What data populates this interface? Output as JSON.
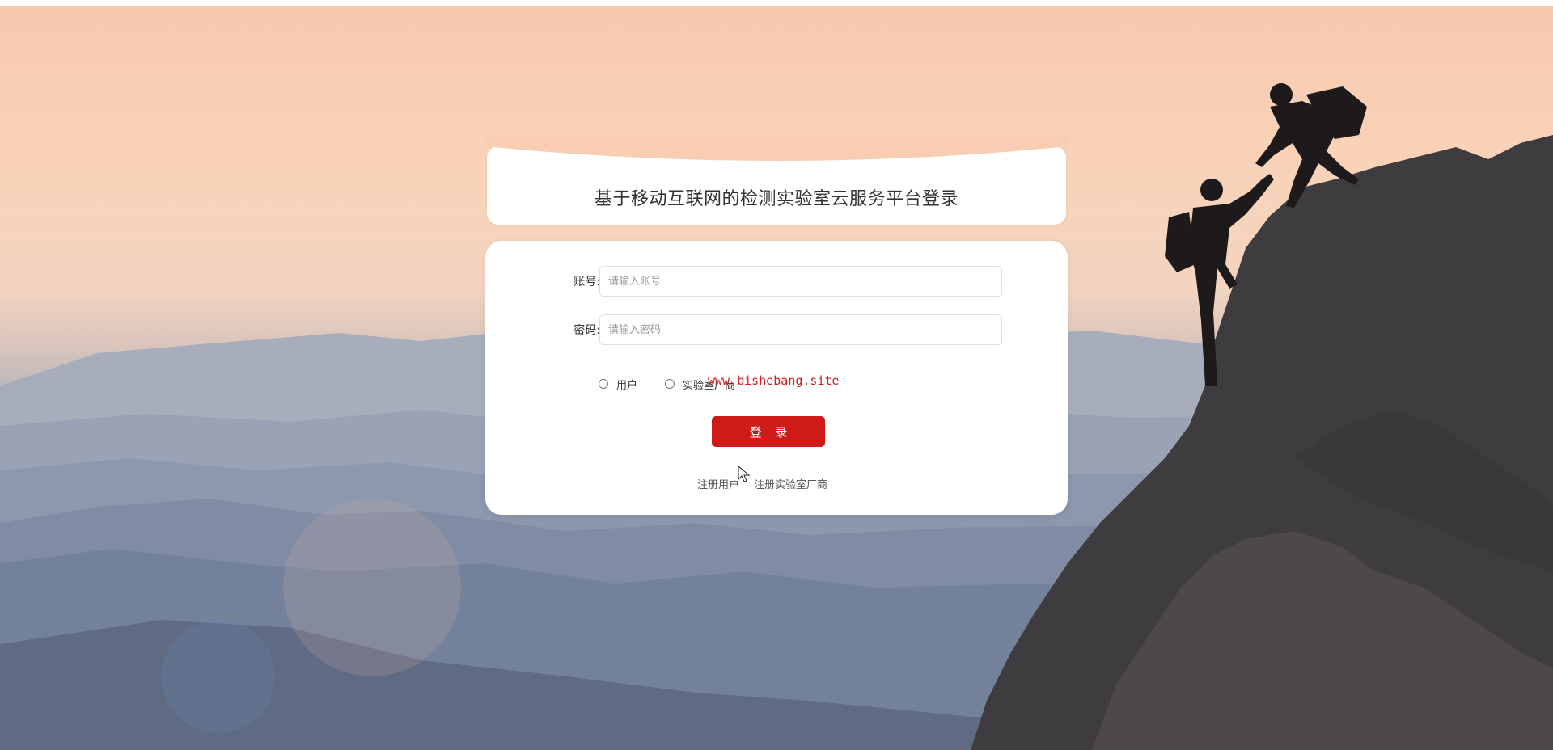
{
  "title": "基于移动互联网的检测实验室云服务平台登录",
  "form": {
    "account_label": "账号:",
    "account_placeholder": "请输入账号",
    "password_label": "密码:",
    "password_placeholder": "请输入密码"
  },
  "roles": [
    {
      "label": "用户",
      "selected": false
    },
    {
      "label": "实验室厂商",
      "selected": false
    }
  ],
  "watermark": "www.bishebang.site",
  "login_button": "登 录",
  "links": {
    "register_user": "注册用户",
    "register_lab": "注册实验室厂商"
  }
}
